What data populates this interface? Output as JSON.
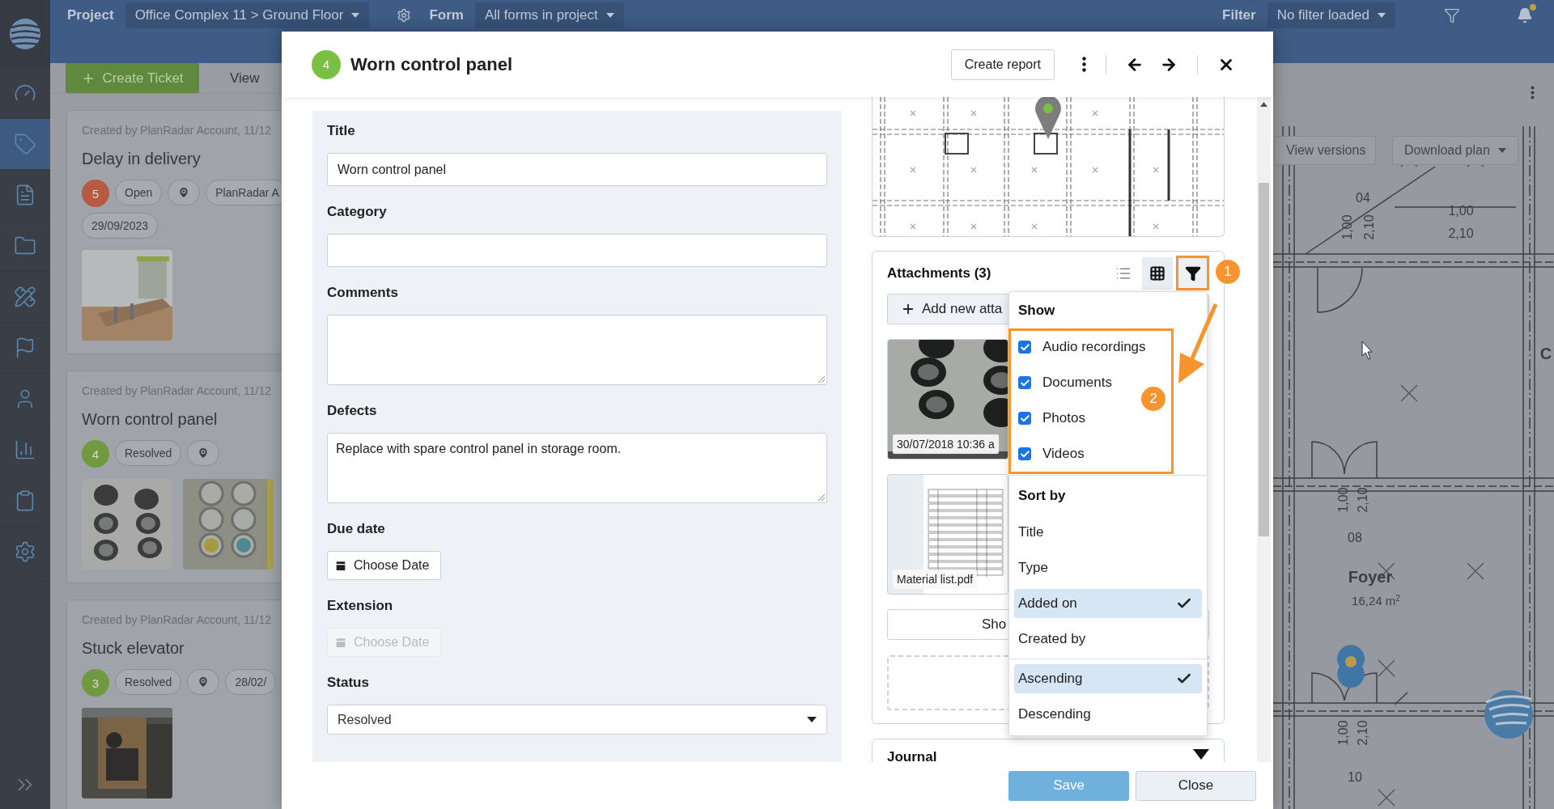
{
  "app_bar": {
    "project_label": "Project",
    "project_value": "Office Complex 11 > Ground Floor",
    "form_label": "Form",
    "form_value": "All forms in project",
    "filter_label": "Filter",
    "filter_value": "No filter loaded"
  },
  "sidebar": {
    "items": [
      {
        "kind": "dashboard",
        "selected": false
      },
      {
        "kind": "tickets",
        "selected": true
      },
      {
        "kind": "reports",
        "selected": false
      },
      {
        "kind": "documents",
        "selected": false
      },
      {
        "kind": "plans",
        "selected": false
      },
      {
        "kind": "milestones",
        "selected": false
      },
      {
        "kind": "users",
        "selected": false
      },
      {
        "kind": "statistics",
        "selected": false
      },
      {
        "kind": "forms",
        "selected": false
      },
      {
        "kind": "settings",
        "selected": false
      }
    ]
  },
  "list_toolbar": {
    "create_button": "Create Ticket",
    "view_label": "View"
  },
  "tickets": [
    {
      "meta": "Created by PlanRadar Account, 11/12",
      "title": "Delay in delivery",
      "number": "5",
      "color": "#b85a43",
      "status": "Open",
      "chips": [
        "PlanRadar A",
        "29/09/2023"
      ],
      "pictures": [
        {
          "kind": "picture"
        }
      ]
    },
    {
      "meta": "Created by PlanRadar Account, 11/12",
      "title": "Worn control panel",
      "number": "4",
      "color": "#6f9a3f",
      "status": "Resolved",
      "pictures": [
        {
          "kind": "picture"
        },
        {
          "kind": "picture"
        }
      ]
    },
    {
      "meta": "Created by PlanRadar Account, 11/12",
      "title": "Stuck elevator",
      "number": "3",
      "color": "#6f9a3f",
      "status": "Resolved",
      "chips": [
        "28/02/"
      ],
      "pictures": [
        {
          "kind": "picture"
        }
      ]
    }
  ],
  "plan": {
    "view_versions": "View versions",
    "download_plan": "Download plan",
    "labels": [
      {
        "kind": "dimension",
        "text": "04"
      },
      {
        "kind": "dimension",
        "text": "1,00"
      },
      {
        "kind": "dimension",
        "text": "2,10"
      },
      {
        "kind": "dimension",
        "text": "1,00"
      },
      {
        "kind": "dimension",
        "text": "2,10"
      },
      {
        "kind": "room",
        "text": "C"
      },
      {
        "kind": "dimension",
        "text": "1,00"
      },
      {
        "kind": "dimension",
        "text": "2,10"
      },
      {
        "kind": "dimension",
        "text": "08"
      },
      {
        "kind": "room",
        "text": "Foyer"
      },
      {
        "kind": "area",
        "text": "16,24 m$^{2}$"
      },
      {
        "kind": "dimension",
        "text": "1,00"
      },
      {
        "kind": "dimension",
        "text": "2,10"
      },
      {
        "kind": "dimension",
        "text": "10"
      }
    ]
  },
  "dialog": {
    "number": "4",
    "title": "Worn control panel",
    "create_report": "Create report",
    "fields": [
      {
        "kind": "text",
        "label": "Title",
        "value": "Worn control panel"
      },
      {
        "kind": "text",
        "label": "Category"
      },
      {
        "kind": "textarea",
        "label": "Comments"
      },
      {
        "kind": "textarea",
        "label": "Defects",
        "value": "Replace with spare control panel in storage room."
      },
      {
        "kind": "date",
        "label": "Due date",
        "placeholder": "Choose Date",
        "disabled": false
      },
      {
        "kind": "date",
        "label": "Extension",
        "placeholder": "Choose Date",
        "disabled": true
      },
      {
        "kind": "select",
        "label": "Status",
        "value": "Resolved"
      }
    ],
    "attachments": {
      "title": "Attachments (3)",
      "view_modes": [
        {
          "kind": "list",
          "selected": false
        },
        {
          "kind": "grid",
          "selected": true
        }
      ],
      "add_button": "Add new atta",
      "items": [
        {
          "caption": "30/07/2018 10:36 a"
        },
        {
          "kind": "document",
          "caption": "Material list.pdf"
        }
      ],
      "show_more": "Sho"
    },
    "filter_menu": {
      "show_title": "Show",
      "types": [
        {
          "label": "Audio recordings",
          "checked": true
        },
        {
          "label": "Documents",
          "checked": true
        },
        {
          "label": "Photos",
          "checked": true
        },
        {
          "label": "Videos",
          "checked": true
        }
      ],
      "sort_title": "Sort by",
      "sort_fields": [
        {
          "label": "Title",
          "selected": false
        },
        {
          "label": "Type",
          "selected": false
        },
        {
          "label": "Added on",
          "selected": true
        },
        {
          "label": "Created by",
          "selected": false
        }
      ],
      "orders": [
        {
          "label": "Ascending",
          "selected": true
        },
        {
          "label": "Descending",
          "selected": false
        }
      ]
    },
    "callouts": [
      "1",
      "2"
    ],
    "journal": "Journal",
    "save": "Save",
    "close": "Close"
  }
}
